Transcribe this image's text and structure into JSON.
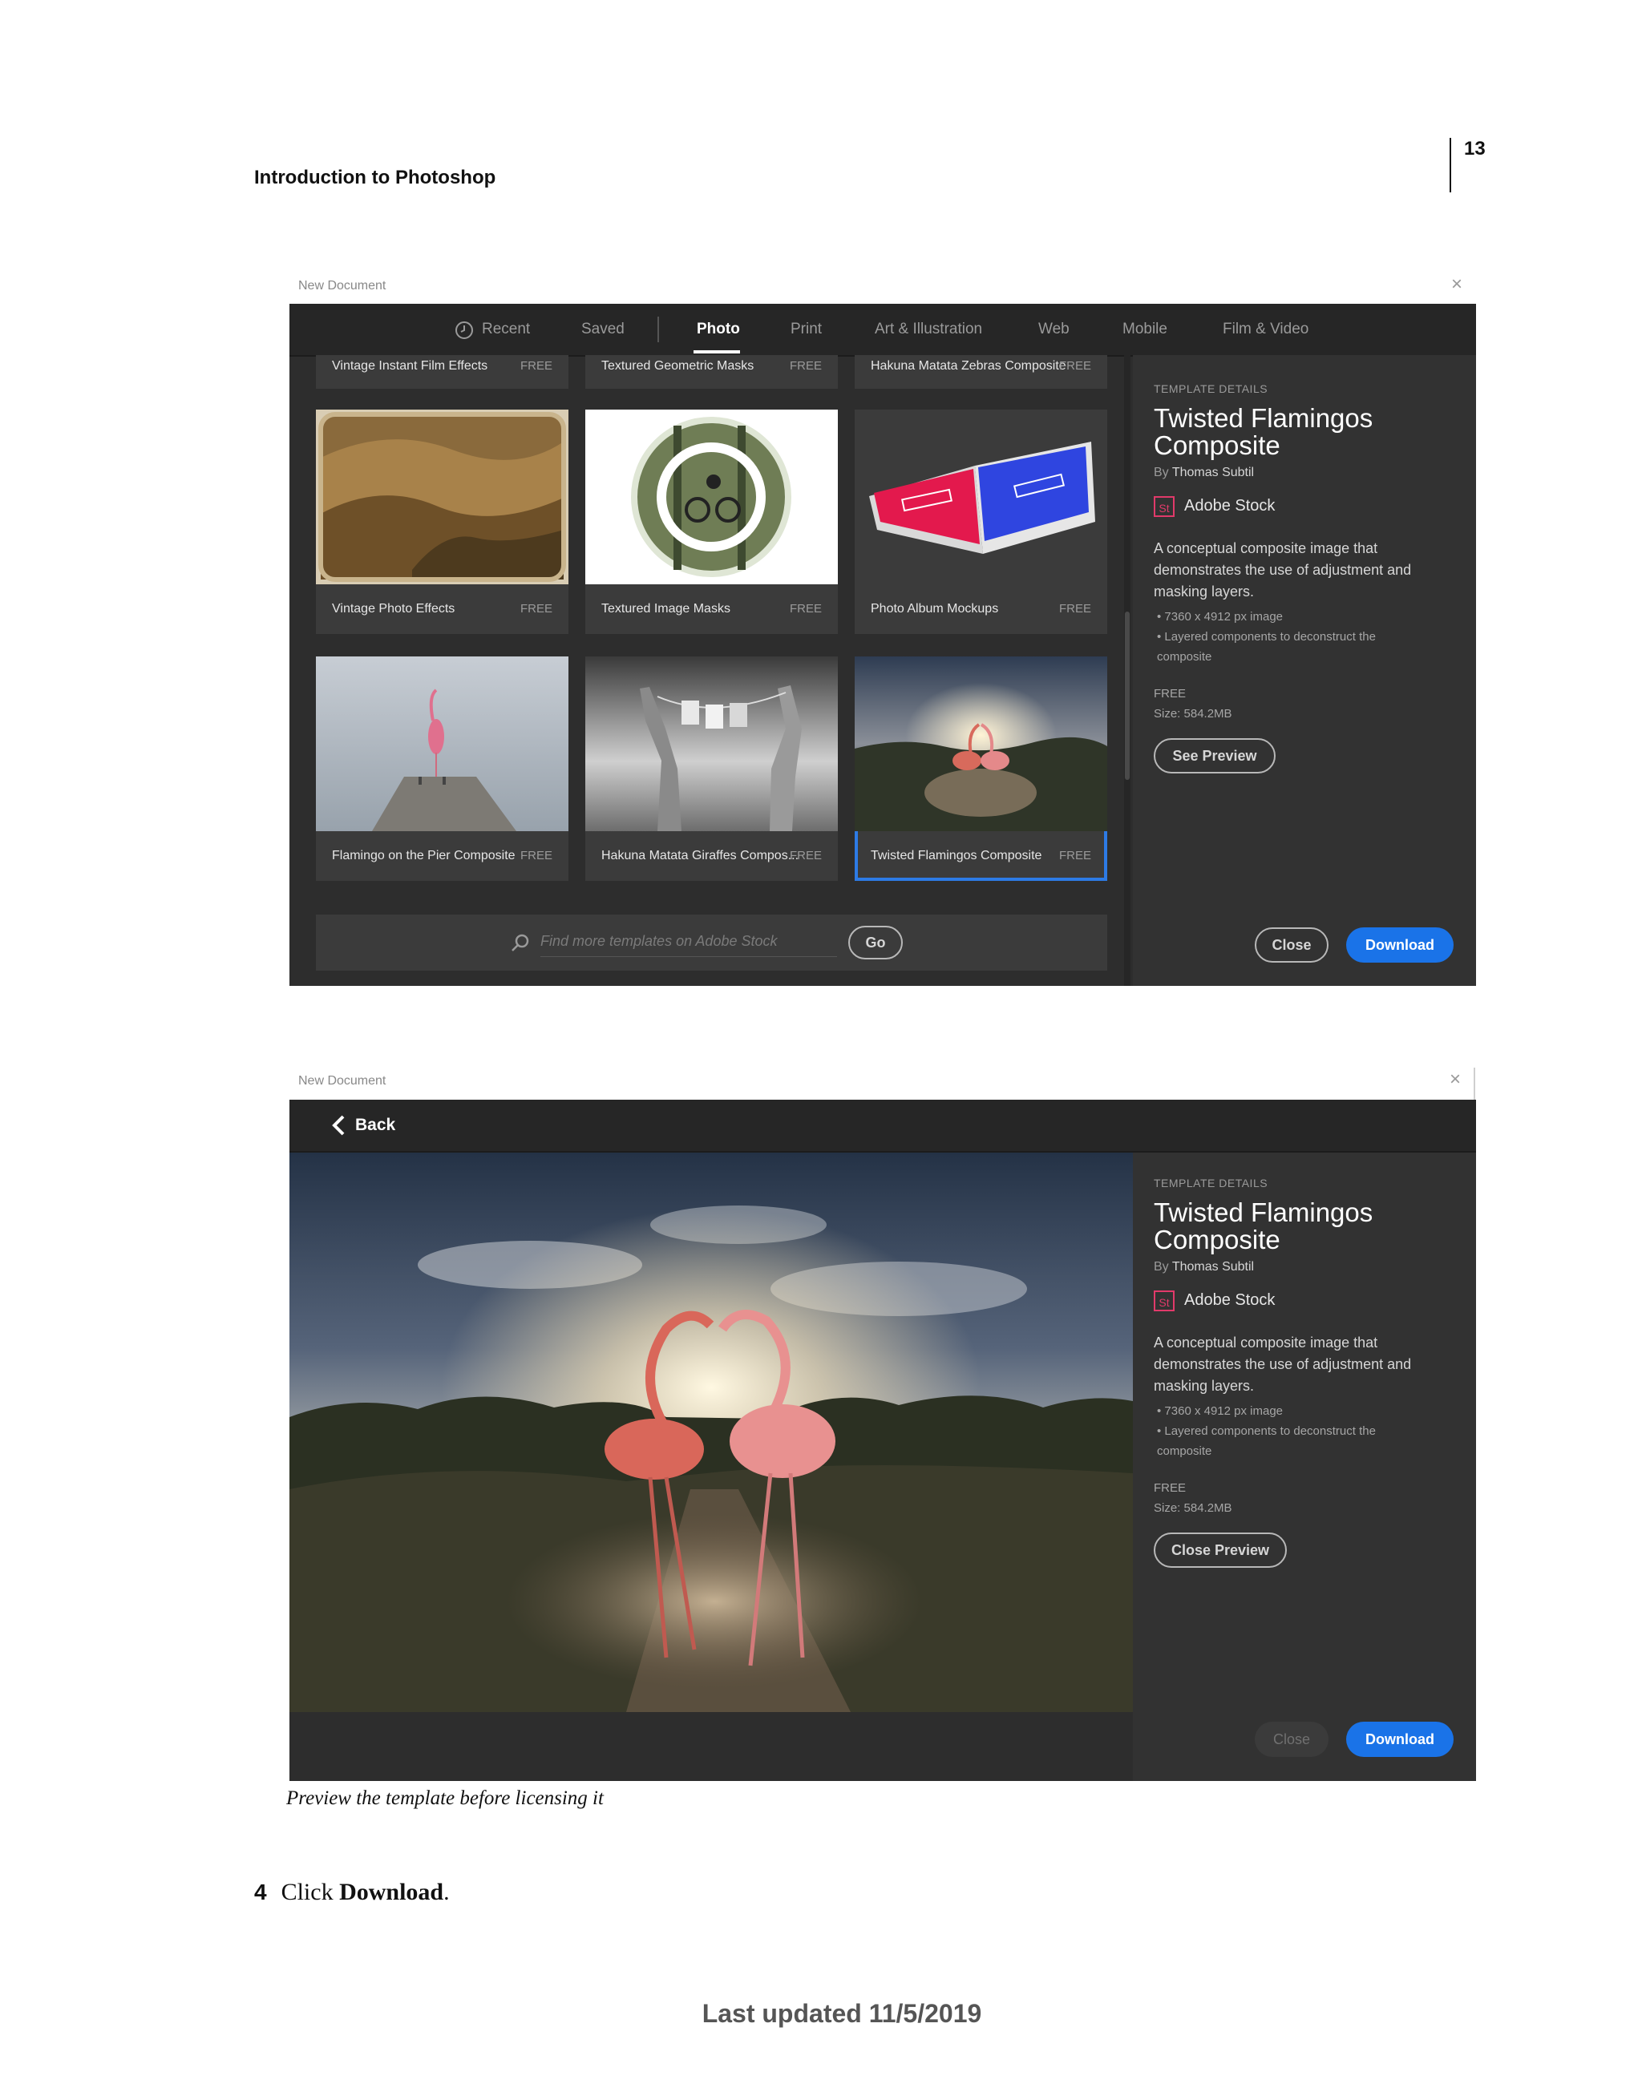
{
  "page": {
    "header_title": "Introduction to Photoshop",
    "page_number": "13",
    "caption": "Preview the template before licensing it",
    "step_number": "4",
    "step_prefix": "Click ",
    "step_bold": "Download",
    "step_suffix": ".",
    "footer": "Last updated 11/5/2019"
  },
  "dialog1": {
    "caption": "New Document",
    "close_glyph": "×",
    "tabs": [
      "Recent",
      "Saved",
      "Photo",
      "Print",
      "Art & Illustration",
      "Web",
      "Mobile",
      "Film & Video"
    ],
    "active_tab": "Photo",
    "recent_icon": "clock-icon",
    "top_row": [
      {
        "label": "Vintage Instant Film Effects",
        "badge": "FREE"
      },
      {
        "label": "Textured Geometric Masks",
        "badge": "FREE"
      },
      {
        "label": "Hakuna Matata Zebras Composite",
        "badge": "FREE"
      }
    ],
    "row1": [
      {
        "label": "Vintage Photo Effects",
        "badge": "FREE"
      },
      {
        "label": "Textured Image Masks",
        "badge": "FREE"
      },
      {
        "label": "Photo Album Mockups",
        "badge": "FREE"
      }
    ],
    "row2": [
      {
        "label": "Flamingo on the Pier Composite",
        "badge": "FREE"
      },
      {
        "label": "Hakuna Matata Giraffes Compos...",
        "badge": "FREE"
      },
      {
        "label": "Twisted Flamingos Composite",
        "badge": "FREE"
      }
    ],
    "search_placeholder": "Find more templates on Adobe Stock",
    "go_label": "Go",
    "search_icon": "search-icon",
    "panel": {
      "heading": "TEMPLATE DETAILS",
      "title_line1": "Twisted Flamingos",
      "title_line2": "Composite",
      "by_prefix": "By ",
      "author": "Thomas Subtil",
      "brand_logo": "St",
      "brand": "Adobe Stock",
      "description": "A conceptual composite image that demonstrates the use of adjustment and masking layers.",
      "bullets": [
        "7360 x 4912 px image",
        "Layered components to deconstruct the composite"
      ],
      "price": "FREE",
      "size": "Size: 584.2MB",
      "preview_button": "See Preview",
      "close_button": "Close",
      "download_button": "Download"
    }
  },
  "dialog2": {
    "caption": "New Document",
    "close_glyph": "×",
    "back_label": "Back",
    "back_icon": "chevron-left-icon",
    "panel": {
      "heading": "TEMPLATE DETAILS",
      "title_line1": "Twisted Flamingos",
      "title_line2": "Composite",
      "by_prefix": "By ",
      "author": "Thomas Subtil",
      "brand_logo": "St",
      "brand": "Adobe Stock",
      "description": "A conceptual composite image that demonstrates the use of adjustment and masking layers.",
      "bullets": [
        "7360 x 4912 px image",
        "Layered components to deconstruct the composite"
      ],
      "price": "FREE",
      "size": "Size: 584.2MB",
      "preview_button": "Close Preview",
      "close_button": "Close",
      "download_button": "Download"
    }
  }
}
